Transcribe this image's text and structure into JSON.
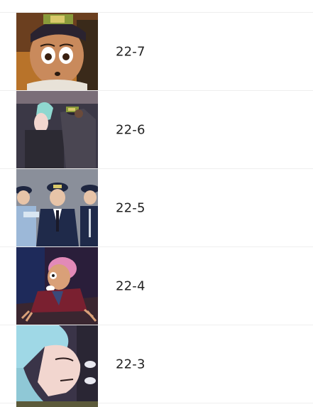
{
  "episodes": [
    {
      "label": "22-7",
      "thumb_icon": "comic-panel-thumbnail"
    },
    {
      "label": "22-6",
      "thumb_icon": "comic-panel-thumbnail"
    },
    {
      "label": "22-5",
      "thumb_icon": "comic-panel-thumbnail"
    },
    {
      "label": "22-4",
      "thumb_icon": "comic-panel-thumbnail"
    },
    {
      "label": "22-3",
      "thumb_icon": "comic-panel-thumbnail"
    }
  ],
  "colors": {
    "divider": "#eeeeee",
    "text": "#222222",
    "background": "#ffffff"
  }
}
